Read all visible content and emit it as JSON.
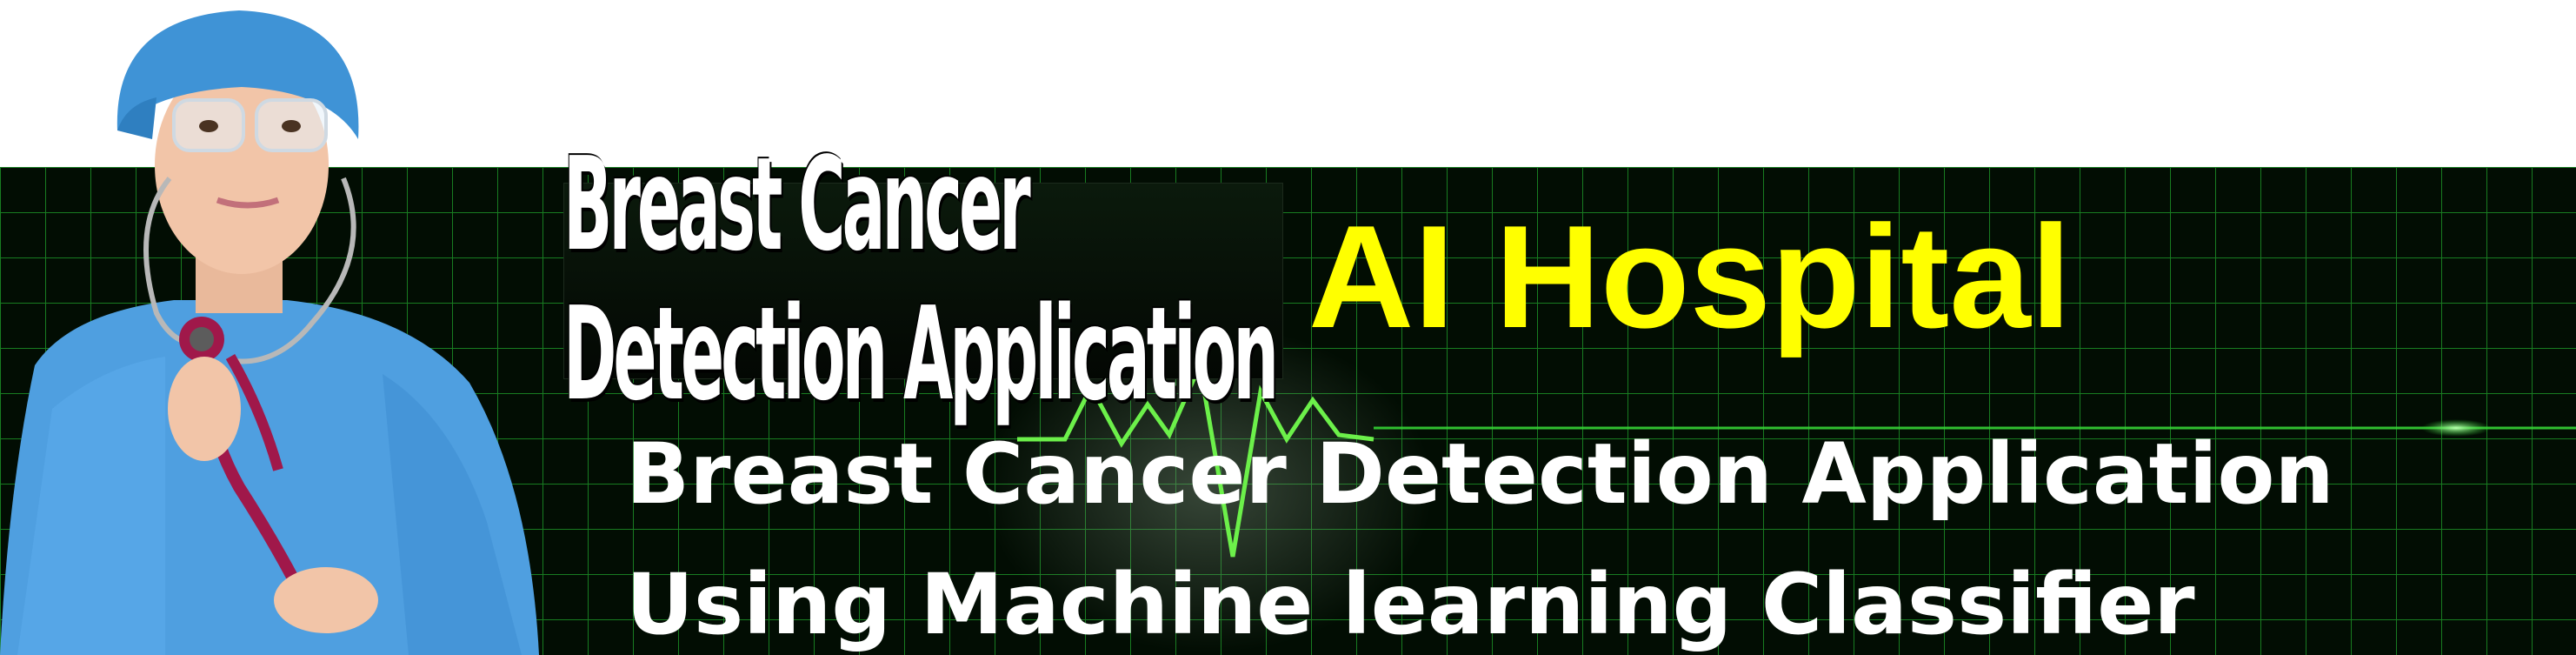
{
  "banner": {
    "logo_text": "Breast Cancer Detection Application",
    "brand_title": "AI Hospital",
    "subtitle_line1": "Breast Cancer Detection Application",
    "subtitle_line2": "Using Machine learning Classifier"
  },
  "colors": {
    "background_top": "#ffffff",
    "banner_background": "#020d03",
    "grid_line": "#1fa12a",
    "ecg_line": "#6cf04a",
    "brand_title": "#ffff00",
    "subtitle": "#ffffff",
    "scrubs": "#4f9fe0"
  },
  "images": {
    "nurse": "doctor-with-stethoscope-illustration",
    "ecg": "heartbeat-line"
  }
}
